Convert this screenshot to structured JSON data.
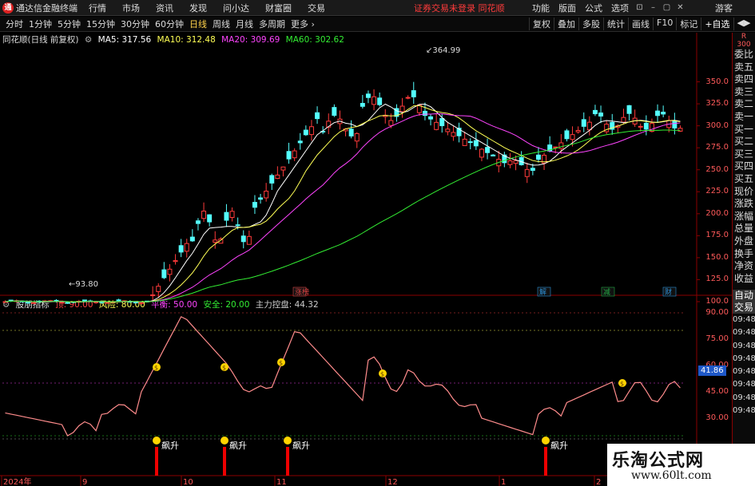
{
  "app": {
    "title": "通达信金融终端",
    "menus": [
      "行情",
      "市场",
      "资讯",
      "发现",
      "问小达",
      "财富圈",
      "交易"
    ],
    "notice": "证券交易未登录  同花顺",
    "right_menus": [
      "功能",
      "版面",
      "公式",
      "选项"
    ],
    "window_buttons": [
      "⊡",
      "–",
      "▢",
      "✕"
    ],
    "guest": "游客"
  },
  "periods": {
    "items": [
      "分时",
      "1分钟",
      "5分钟",
      "15分钟",
      "30分钟",
      "60分钟",
      "日线",
      "周线",
      "月线",
      "多周期",
      "更多 ›"
    ],
    "active": "日线"
  },
  "tools": [
    "复权",
    "叠加",
    "多股",
    "统计",
    "画线",
    "F10",
    "标记",
    "+自选",
    "◀▶"
  ],
  "main_chart": {
    "stock_label": "同花顺(日线 前复权)",
    "ma": [
      {
        "label": "MA5: 317.56",
        "color": "#ffffff"
      },
      {
        "label": "MA10: 312.48",
        "color": "#ffff55"
      },
      {
        "label": "MA20: 309.69",
        "color": "#ff44ff"
      },
      {
        "label": "MA60: 302.62",
        "color": "#33ee33"
      }
    ],
    "y_ticks": [
      "350.0",
      "325.0",
      "300.0",
      "275.0",
      "250.0",
      "225.0",
      "200.0",
      "175.0",
      "150.0",
      "125.0",
      "100.0"
    ],
    "high_label": "364.99",
    "low_label": "93.80",
    "event_tags": [
      {
        "label": "涨榜",
        "color": "#d44"
      },
      {
        "label": "解",
        "color": "#2a8fd6"
      },
      {
        "label": "减",
        "color": "#22aa44"
      },
      {
        "label": "财",
        "color": "#2a8fd6"
      }
    ],
    "corner_labels": [
      "R",
      "300"
    ]
  },
  "indicator": {
    "name": "股朋指标",
    "params": [
      {
        "label": "顶: 90.00",
        "color": "#ff4444"
      },
      {
        "label": "风险: 80.00",
        "color": "#ffff55"
      },
      {
        "label": "平衡: 50.00",
        "color": "#ff44ff"
      },
      {
        "label": "安全: 20.00",
        "color": "#33ee33"
      },
      {
        "label": "主力控盘: 44.32",
        "color": "#cccccc"
      }
    ],
    "y_ticks": [
      "90.00",
      "75.00",
      "60.00",
      "45.00",
      "30.00"
    ],
    "current_value": "41.86",
    "signal_label": "飙升",
    "signal_icon_label": "$"
  },
  "x_axis": [
    "2024年",
    "9",
    "10",
    "11",
    "12",
    "1",
    "2"
  ],
  "side_panel": [
    "委比",
    "卖五",
    "卖四",
    "卖三",
    "卖二",
    "卖一",
    "买一",
    "买二",
    "买三",
    "买四",
    "买五",
    "现价",
    "涨跌",
    "涨幅",
    "总量",
    "外盘",
    "换手",
    "净资",
    "收益"
  ],
  "side_panel_lower": [
    "自动",
    "交易",
    "09:48",
    "09:48",
    "09:48",
    "09:48",
    "09:48",
    "09:48",
    "09:48",
    "09:48"
  ],
  "watermark": {
    "cn": "乐淘公式网",
    "url": "www.60lt.com"
  }
}
